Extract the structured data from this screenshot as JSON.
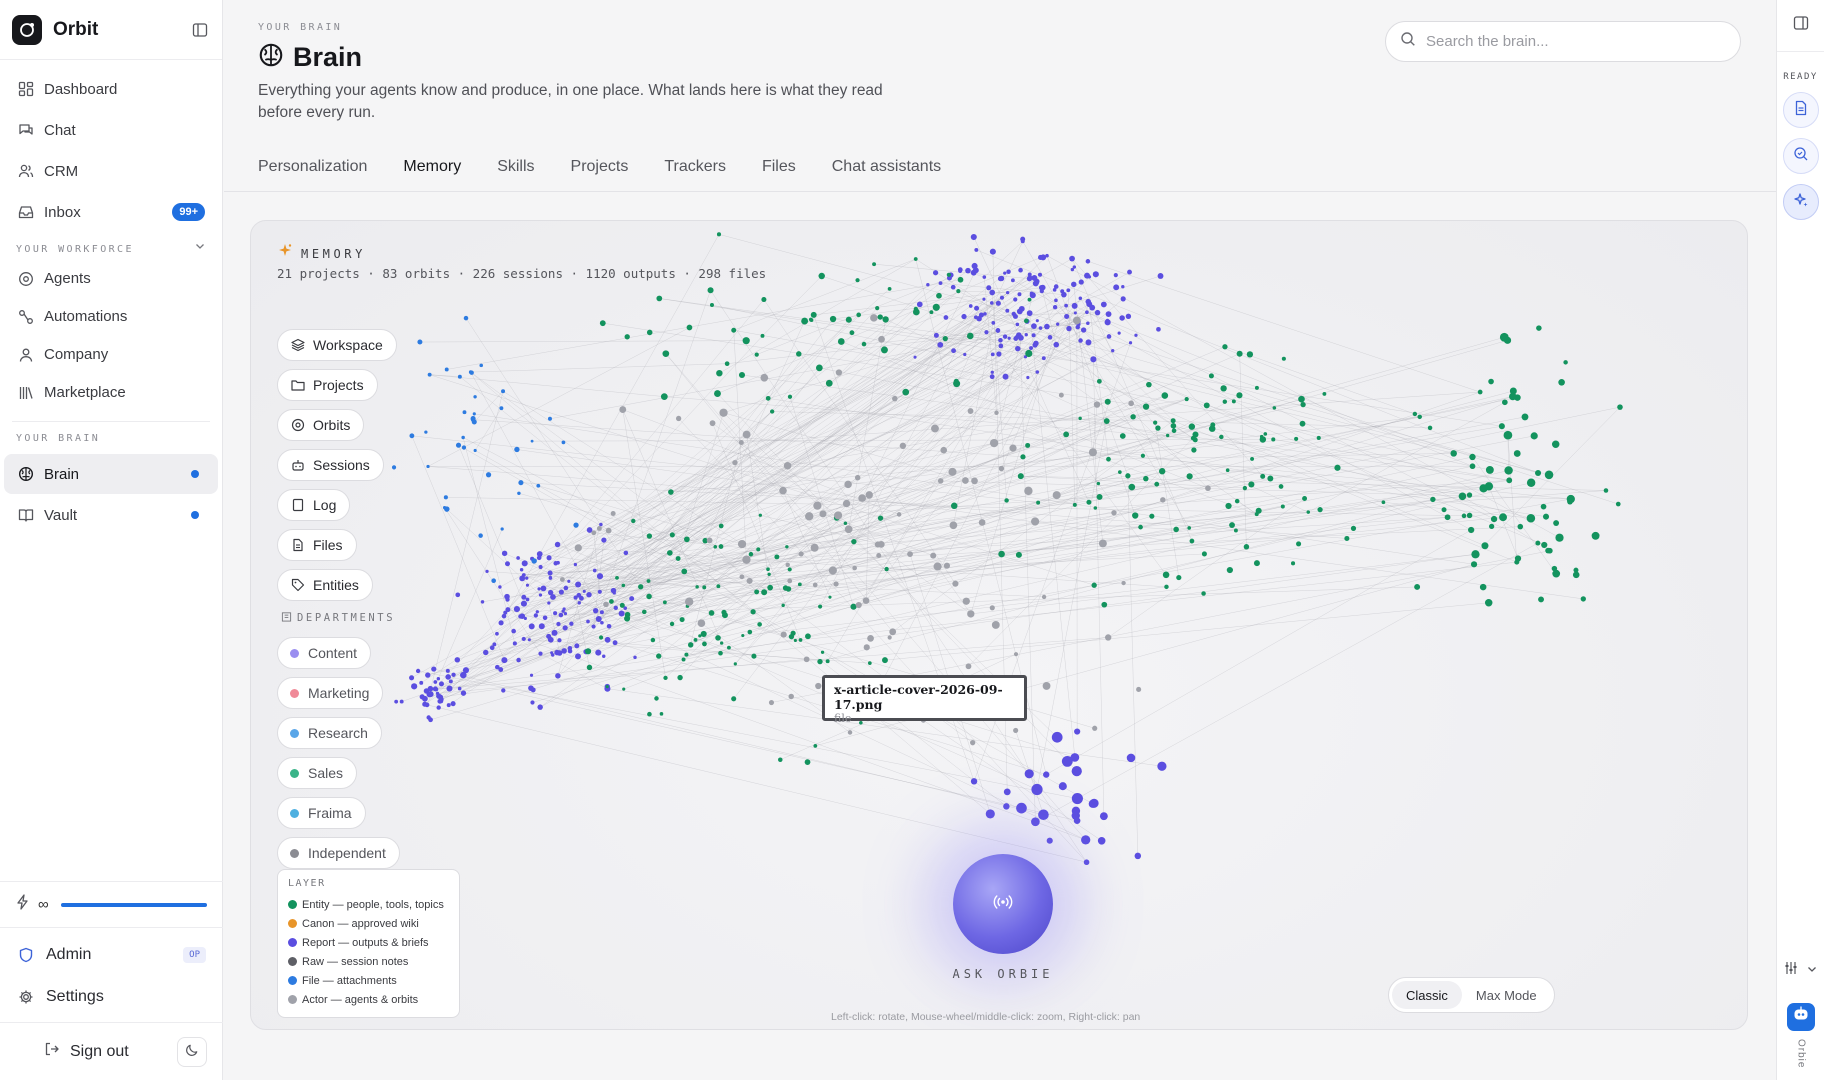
{
  "app": {
    "name": "Orbit"
  },
  "sidebar": {
    "nav": [
      {
        "label": "Dashboard",
        "icon": "dashboard-icon"
      },
      {
        "label": "Chat",
        "icon": "chat-icon"
      },
      {
        "label": "CRM",
        "icon": "users-icon"
      },
      {
        "label": "Inbox",
        "icon": "inbox-icon",
        "badge": "99+"
      }
    ],
    "workforce_label": "YOUR WORKFORCE",
    "workforce": [
      {
        "label": "Agents",
        "icon": "agents-icon"
      },
      {
        "label": "Automations",
        "icon": "automations-icon"
      },
      {
        "label": "Company",
        "icon": "person-icon"
      },
      {
        "label": "Marketplace",
        "icon": "library-icon"
      }
    ],
    "brain_label": "YOUR BRAIN",
    "brain": [
      {
        "label": "Brain",
        "icon": "brain-icon",
        "active": true
      },
      {
        "label": "Vault",
        "icon": "book-icon"
      }
    ],
    "credits": "∞",
    "admin_label": "Admin",
    "admin_badge": "OP",
    "settings_label": "Settings",
    "signout_label": "Sign out"
  },
  "page": {
    "eyebrow": "YOUR BRAIN",
    "title": "Brain",
    "description": "Everything your agents know and produce, in one place. What lands here is what they read before every run.",
    "search_placeholder": "Search the brain...",
    "tabs": [
      "Personalization",
      "Memory",
      "Skills",
      "Projects",
      "Trackers",
      "Files",
      "Chat assistants"
    ],
    "active_tab": "Memory"
  },
  "memory": {
    "label": "MEMORY",
    "stats": "21 projects · 83 orbits · 226 sessions · 1120 outputs · 298 files",
    "filters": [
      "Workspace",
      "Projects",
      "Orbits",
      "Sessions",
      "Log",
      "Files",
      "Entities"
    ],
    "departments_label": "DEPARTMENTS",
    "departments": [
      {
        "label": "Content",
        "color": "#9a8ef0"
      },
      {
        "label": "Marketing",
        "color": "#f08a98"
      },
      {
        "label": "Research",
        "color": "#5aa6e8"
      },
      {
        "label": "Sales",
        "color": "#3ab489"
      },
      {
        "label": "Fraima",
        "color": "#4fb0e0"
      },
      {
        "label": "Independent",
        "color": "#8b8c93"
      }
    ],
    "legend_title": "LAYER",
    "legend": [
      {
        "label": "Entity — people, tools, topics",
        "color": "#13935e"
      },
      {
        "label": "Canon — approved wiki",
        "color": "#e8952a"
      },
      {
        "label": "Report — outputs & briefs",
        "color": "#5b4ee0"
      },
      {
        "label": "Raw — session notes",
        "color": "#5e5f66"
      },
      {
        "label": "File — attachments",
        "color": "#2d7be0"
      },
      {
        "label": "Actor — agents & orbits",
        "color": "#a0a2aa"
      }
    ],
    "tooltip": {
      "name": "x-article-cover-2026-09-17.png",
      "kind": "file"
    },
    "ask_label": "ASK ORBIE",
    "hint": "Left-click: rotate, Mouse-wheel/middle-click: zoom, Right-click: pan",
    "modes": [
      "Classic",
      "Max Mode"
    ],
    "active_mode": "Classic"
  },
  "rail": {
    "status": "READY",
    "assistant_name": "Orbie"
  }
}
